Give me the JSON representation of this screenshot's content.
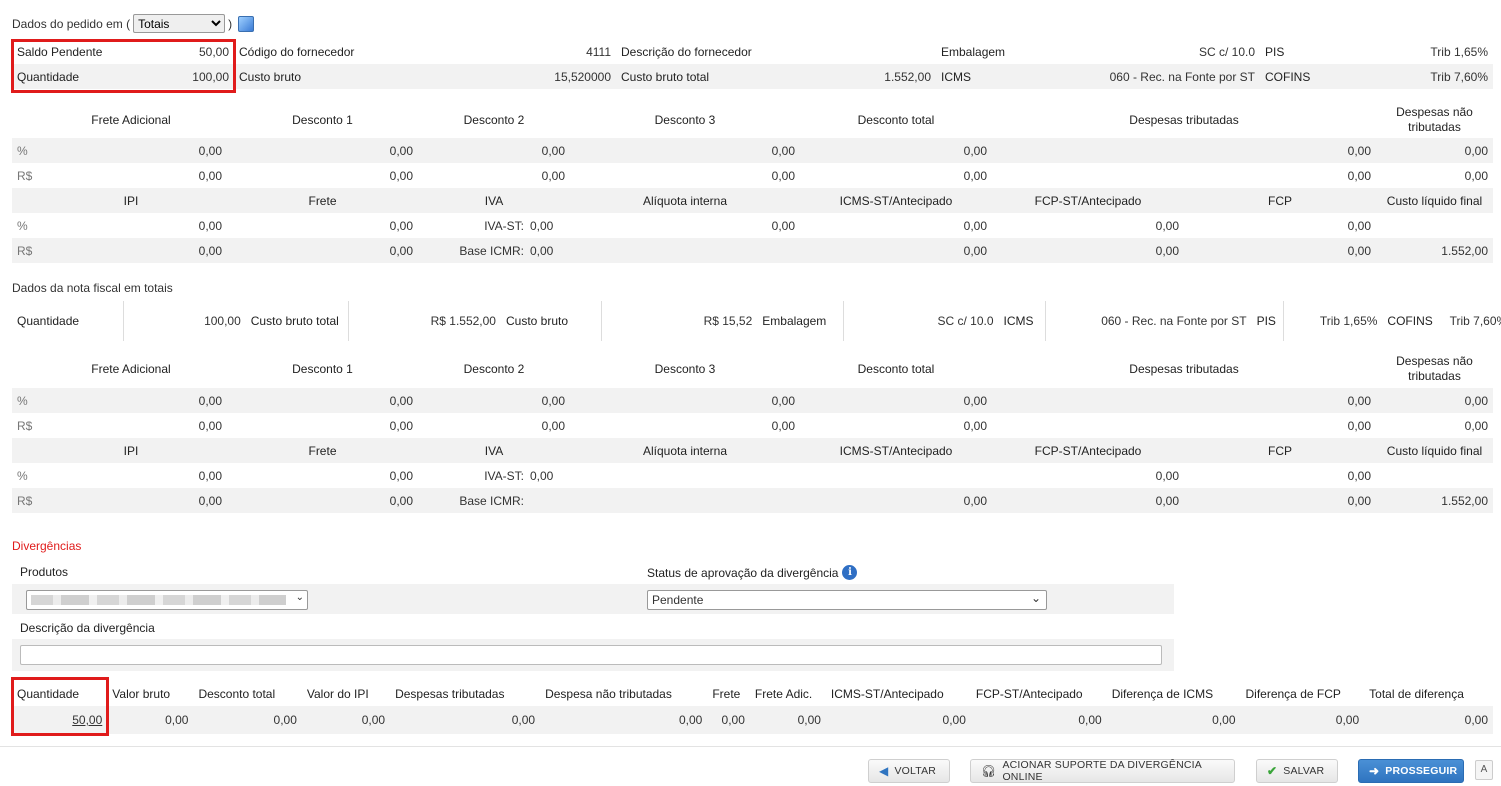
{
  "header": {
    "prefix": "Dados do pedido em (",
    "select_value": "Totais",
    "suffix": ")"
  },
  "pedido_top": {
    "saldo_label": "Saldo Pendente",
    "saldo_value": "50,00",
    "quantidade_label": "Quantidade",
    "quantidade_value": "100,00",
    "codigo_label": "Código do fornecedor",
    "codigo_value": "4111",
    "custo_bruto_label": "Custo bruto",
    "custo_bruto_value": "15,520000",
    "descricao_label": "Descrição do fornecedor",
    "descricao_value": "",
    "custo_bruto_total_label": "Custo bruto total",
    "custo_bruto_total_value": "1.552,00",
    "embalagem_label": "Embalagem",
    "embalagem_value": "SC c/ 10.0",
    "icms_label": "ICMS",
    "icms_value": "060 - Rec. na Fonte por ST",
    "pis_label": "PIS",
    "pis_value": "Trib 1,65%",
    "cofins_label": "COFINS",
    "cofins_value": "Trib 7,60%"
  },
  "grid1": {
    "headers": [
      "Frete Adicional",
      "Desconto 1",
      "Desconto 2",
      "Desconto 3",
      "Desconto total",
      "Despesas tributadas",
      "Despesas não tributadas"
    ],
    "pct_label": "%",
    "rs_label": "R$",
    "pct": [
      "0,00",
      "0,00",
      "0,00",
      "0,00",
      "0,00",
      "0,00",
      "0,00"
    ],
    "rs": [
      "0,00",
      "0,00",
      "0,00",
      "0,00",
      "0,00",
      "0,00",
      "0,00"
    ],
    "headers2": [
      "IPI",
      "Frete",
      "IVA",
      "Alíquota interna",
      "ICMS-ST/Antecipado",
      "FCP-ST/Antecipado",
      "FCP",
      "Custo líquido final"
    ],
    "iva_st_label": "IVA-ST:",
    "base_icmr_label": "Base ICMR:",
    "pct2": {
      "ipi": "0,00",
      "frete": "0,00",
      "iva": "0,00",
      "aliq": "0,00",
      "icmsst": "0,00",
      "fcpst": "0,00",
      "fcp": "0,00",
      "custo": ""
    },
    "rs2": {
      "ipi": "0,00",
      "frete": "0,00",
      "iva": "0,00",
      "aliq": "",
      "icmsst": "0,00",
      "fcpst": "0,00",
      "fcp": "0,00",
      "custo": "1.552,00"
    }
  },
  "nota_title": "Dados da nota fiscal em totais",
  "nota_top": {
    "quantidade_label": "Quantidade",
    "quantidade_value": "100,00",
    "custo_bruto_total_label": "Custo bruto total",
    "custo_bruto_total_value": "R$ 1.552,00",
    "custo_bruto_label": "Custo bruto",
    "custo_bruto_value": "R$ 15,52",
    "embalagem_label": "Embalagem",
    "embalagem_value": "SC c/ 10.0",
    "icms_label": "ICMS",
    "icms_value": "060 - Rec. na Fonte por ST",
    "pis_label": "PIS",
    "pis_value": "Trib 1,65%",
    "cofins_label": "COFINS",
    "cofins_value": "Trib 7,60%"
  },
  "grid2": {
    "pct": [
      "0,00",
      "0,00",
      "0,00",
      "0,00",
      "0,00",
      "0,00",
      "0,00"
    ],
    "rs": [
      "0,00",
      "0,00",
      "0,00",
      "0,00",
      "0,00",
      "0,00",
      "0,00"
    ],
    "pct2": {
      "ipi": "0,00",
      "frete": "0,00",
      "iva": "0,00",
      "aliq": "",
      "icmsst": "",
      "fcpst": "0,00",
      "fcp": "0,00",
      "custo": ""
    },
    "rs2": {
      "ipi": "0,00",
      "frete": "0,00",
      "iva": "",
      "aliq": "",
      "icmsst": "0,00",
      "fcpst": "0,00",
      "fcp": "0,00",
      "custo": "1.552,00"
    }
  },
  "divergencias": {
    "title": "Divergências",
    "produtos_label": "Produtos",
    "status_label": "Status de aprovação da divergência",
    "status_value": "Pendente",
    "descricao_label": "Descrição da divergência",
    "descricao_value": ""
  },
  "div_table": {
    "headers": [
      "Quantidade",
      "Valor bruto",
      "Desconto total",
      "Valor do IPI",
      "Despesas tributadas",
      "Despesa não tributadas",
      "Frete",
      "Frete Adic.",
      "ICMS-ST/Antecipado",
      "FCP-ST/Antecipado",
      "Diferença de ICMS",
      "Diferença de FCP",
      "Total de diferença"
    ],
    "values": [
      "50,00",
      "0,00",
      "0,00",
      "0,00",
      "0,00",
      "0,00",
      "0,00",
      "0,00",
      "0,00",
      "0,00",
      "0,00",
      "0,00",
      "0,00"
    ]
  },
  "buttons": {
    "voltar": "VOLTAR",
    "suporte": "ACIONAR SUPORTE DA DIVERGÊNCIA ONLINE",
    "salvar": "SALVAR",
    "prosseguir": "PROSSEGUIR"
  },
  "colors": {
    "accent_red": "#e01b1b",
    "primary_blue": "#2f74c0",
    "zebra": "#f2f2f2"
  }
}
